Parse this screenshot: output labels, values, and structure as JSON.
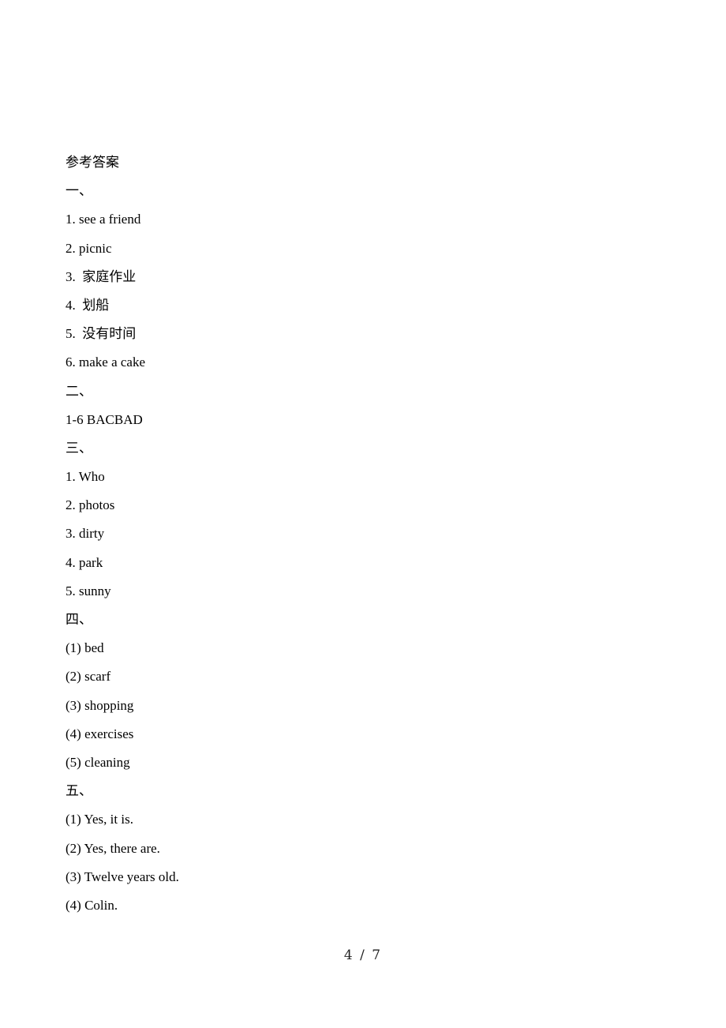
{
  "document": {
    "title": "参考答案",
    "sections": [
      {
        "heading": "一、",
        "items": [
          "1. see a friend",
          "2. picnic",
          "3.  家庭作业",
          "4.  划船",
          "5.  没有时间",
          "6. make a cake"
        ]
      },
      {
        "heading": "二、",
        "items": [
          "1-6 BACBAD"
        ]
      },
      {
        "heading": "三、",
        "items": [
          "1. Who",
          "2. photos",
          "3. dirty",
          "4. park",
          "5. sunny"
        ]
      },
      {
        "heading": "四、",
        "items": [
          "(1) bed",
          "(2) scarf",
          "(3) shopping",
          "(4) exercises",
          "(5) cleaning"
        ]
      },
      {
        "heading": "五、",
        "items": [
          "(1) Yes, it is.",
          "(2) Yes, there are.",
          "(3) Twelve years old.",
          "(4) Colin."
        ]
      }
    ]
  },
  "footer": {
    "page_indicator": "4 / 7"
  }
}
